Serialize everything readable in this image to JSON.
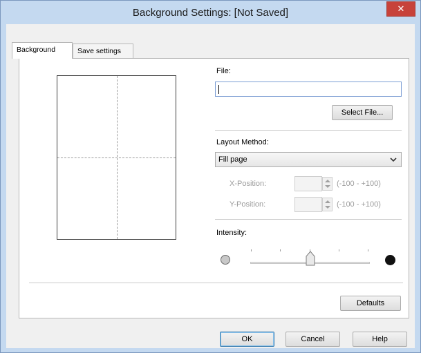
{
  "window": {
    "title": "Background Settings: [Not Saved]",
    "close_glyph": "✕"
  },
  "tabs": [
    {
      "label": "Background",
      "active": true
    },
    {
      "label": "Save settings",
      "active": false
    }
  ],
  "file": {
    "label": "File:",
    "value": "",
    "select_button": "Select File..."
  },
  "layout": {
    "label": "Layout Method:",
    "selected": "Fill page",
    "x_label": "X-Position:",
    "x_range": "(-100 - +100)",
    "y_label": "Y-Position:",
    "y_range": "(-100 - +100)"
  },
  "intensity": {
    "label": "Intensity:",
    "value_fraction": 0.5
  },
  "buttons": {
    "defaults": "Defaults",
    "ok": "OK",
    "cancel": "Cancel",
    "help": "Help"
  },
  "colors": {
    "titlebar": "#c4d9f0",
    "close": "#c7423a",
    "focus_border": "#3c7fb1"
  }
}
